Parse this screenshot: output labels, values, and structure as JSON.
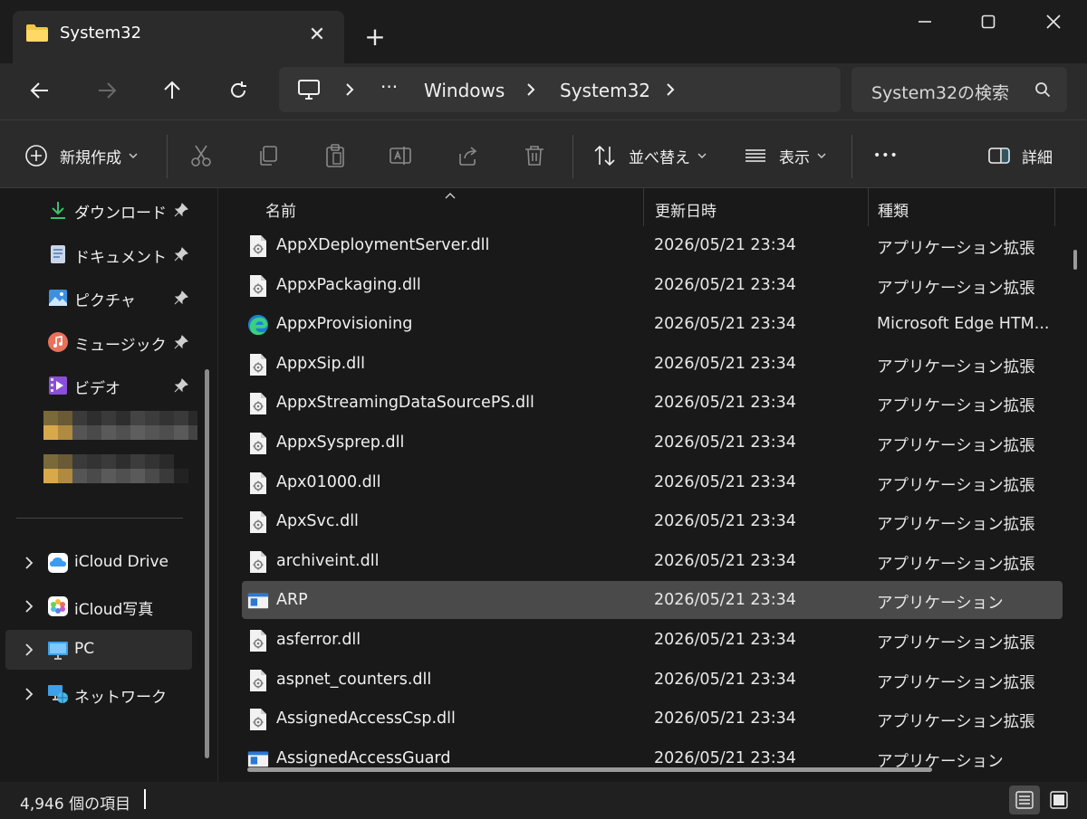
{
  "tab": {
    "title": "System32",
    "close": "✕",
    "new": "+"
  },
  "window": {
    "minimize": "—",
    "maximize": "☐",
    "close": "✕"
  },
  "address": {
    "overflow": "···",
    "crumbs": [
      "Windows",
      "System32"
    ]
  },
  "search": {
    "placeholder": "System32の検索"
  },
  "commands": {
    "new": "新規作成",
    "sort": "並べ替え",
    "view": "表示",
    "more": "•••",
    "details": "詳細"
  },
  "sidebar": {
    "quick": [
      {
        "label": "ダウンロード",
        "icon": "download-icon"
      },
      {
        "label": "ドキュメント",
        "icon": "document-icon"
      },
      {
        "label": "ピクチャ",
        "icon": "pictures-icon"
      },
      {
        "label": "ミュージック",
        "icon": "music-icon"
      },
      {
        "label": "ビデオ",
        "icon": "video-icon"
      }
    ],
    "tree": [
      {
        "label": "iCloud Drive",
        "icon": "icloud-drive-icon"
      },
      {
        "label": "iCloud写真",
        "icon": "icloud-photos-icon"
      },
      {
        "label": "PC",
        "icon": "pc-icon",
        "selected": true
      },
      {
        "label": "ネットワーク",
        "icon": "network-icon"
      }
    ]
  },
  "columns": {
    "name": "名前",
    "date": "更新日時",
    "type": "種類"
  },
  "files": [
    {
      "name": "AppXDeploymentServer.dll",
      "date": "2026/05/21 23:34",
      "type": "アプリケーション拡張",
      "icon": "dll"
    },
    {
      "name": "AppxPackaging.dll",
      "date": "2026/05/21 23:34",
      "type": "アプリケーション拡張",
      "icon": "dll"
    },
    {
      "name": "AppxProvisioning",
      "date": "2026/05/21 23:34",
      "type": "Microsoft Edge HTM...",
      "icon": "edge"
    },
    {
      "name": "AppxSip.dll",
      "date": "2026/05/21 23:34",
      "type": "アプリケーション拡張",
      "icon": "dll"
    },
    {
      "name": "AppxStreamingDataSourcePS.dll",
      "date": "2026/05/21 23:34",
      "type": "アプリケーション拡張",
      "icon": "dll"
    },
    {
      "name": "AppxSysprep.dll",
      "date": "2026/05/21 23:34",
      "type": "アプリケーション拡張",
      "icon": "dll"
    },
    {
      "name": "Apx01000.dll",
      "date": "2026/05/21 23:34",
      "type": "アプリケーション拡張",
      "icon": "dll"
    },
    {
      "name": "ApxSvc.dll",
      "date": "2026/05/21 23:34",
      "type": "アプリケーション拡張",
      "icon": "dll"
    },
    {
      "name": "archiveint.dll",
      "date": "2026/05/21 23:34",
      "type": "アプリケーション拡張",
      "icon": "dll"
    },
    {
      "name": "ARP",
      "date": "2026/05/21 23:34",
      "type": "アプリケーション",
      "icon": "exe",
      "selected": true
    },
    {
      "name": "asferror.dll",
      "date": "2026/05/21 23:34",
      "type": "アプリケーション拡張",
      "icon": "dll"
    },
    {
      "name": "aspnet_counters.dll",
      "date": "2026/05/21 23:34",
      "type": "アプリケーション拡張",
      "icon": "dll"
    },
    {
      "name": "AssignedAccessCsp.dll",
      "date": "2026/05/21 23:34",
      "type": "アプリケーション拡張",
      "icon": "dll"
    },
    {
      "name": "AssignedAccessGuard",
      "date": "2026/05/21 23:34",
      "type": "アプリケーション",
      "icon": "exe"
    }
  ],
  "status": {
    "count": "4,946 個の項目"
  },
  "colors": {
    "accent": "#60cdff",
    "selected_row": "#4a4a4a",
    "folder": "#f4c542"
  }
}
